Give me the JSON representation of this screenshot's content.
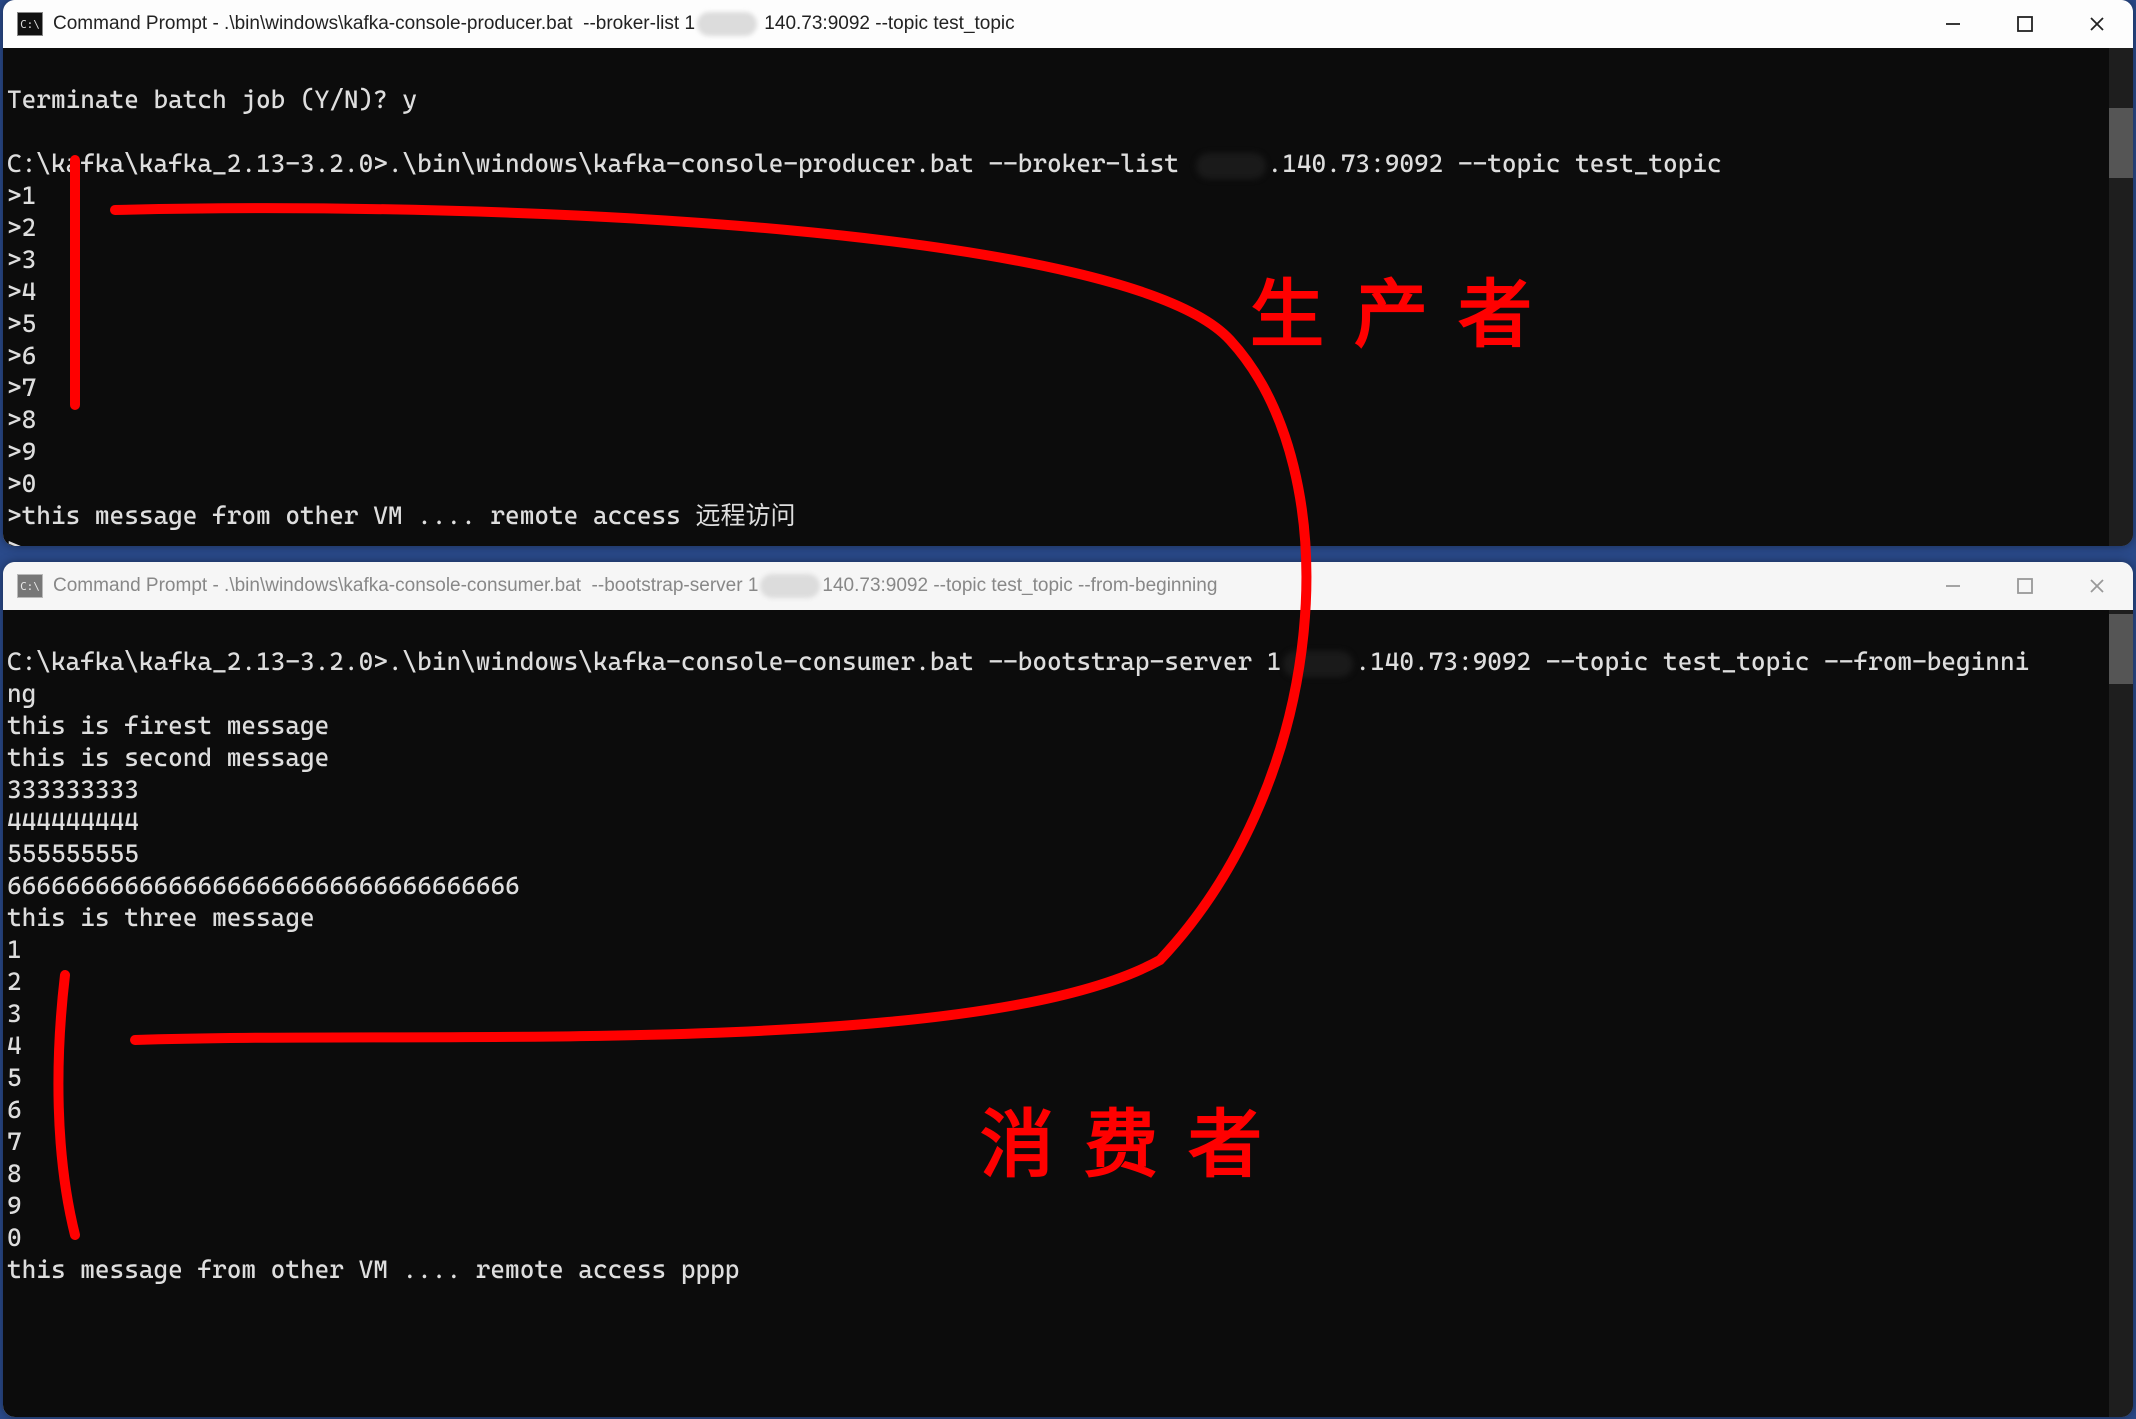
{
  "window1": {
    "title_prefix": "Command Prompt - .\\bin\\windows\\kafka-console-producer.bat  --broker-list 1",
    "title_suffix": " 140.73:9092 --topic test_topic",
    "terminal": {
      "line0": "Terminate batch job (Y/N)? y",
      "blank1": "",
      "path": "C:\\kafka\\kafka_2.13-3.2.0>",
      "cmd_pre": ".\\bin\\windows\\kafka-console-producer.bat --broker-list ",
      "cmd_post": ".140.73:9092 --topic test_topic",
      "l1": ">1",
      "l2": ">2",
      "l3": ">3",
      "l4": ">4",
      "l5": ">5",
      "l6": ">6",
      "l7": ">7",
      "l8": ">8",
      "l9": ">9",
      "l10": ">0",
      "l11": ">this message from other VM .... remote access 远程访问",
      "l12": ">"
    }
  },
  "window2": {
    "title_prefix": "Command Prompt - .\\bin\\windows\\kafka-console-consumer.bat  --bootstrap-server 1",
    "title_suffix": "140.73:9092 --topic test_topic --from-beginning",
    "terminal": {
      "path": "C:\\kafka\\kafka_2.13-3.2.0>",
      "cmd_pre": ".\\bin\\windows\\kafka-console-consumer.bat --bootstrap-server 1",
      "cmd_post": ".140.73:9092 --topic test_topic --from-beginni",
      "wrap": "ng",
      "m1": "this is firest message",
      "m2": "this is second message",
      "m3": "333333333",
      "m4": "444444444",
      "m5": "555555555",
      "m6": "66666666666666666666666666666666666",
      "m7": "this is three message",
      "m8": "1",
      "m9": "2",
      "m10": "3",
      "m11": "4",
      "m12": "5",
      "m13": "6",
      "m14": "7",
      "m15": "8",
      "m16": "9",
      "m17": "0",
      "m18": "this message from other VM .... remote access pppp"
    }
  },
  "annotations": {
    "producer_label": "生产者",
    "consumer_label": "消费者"
  }
}
